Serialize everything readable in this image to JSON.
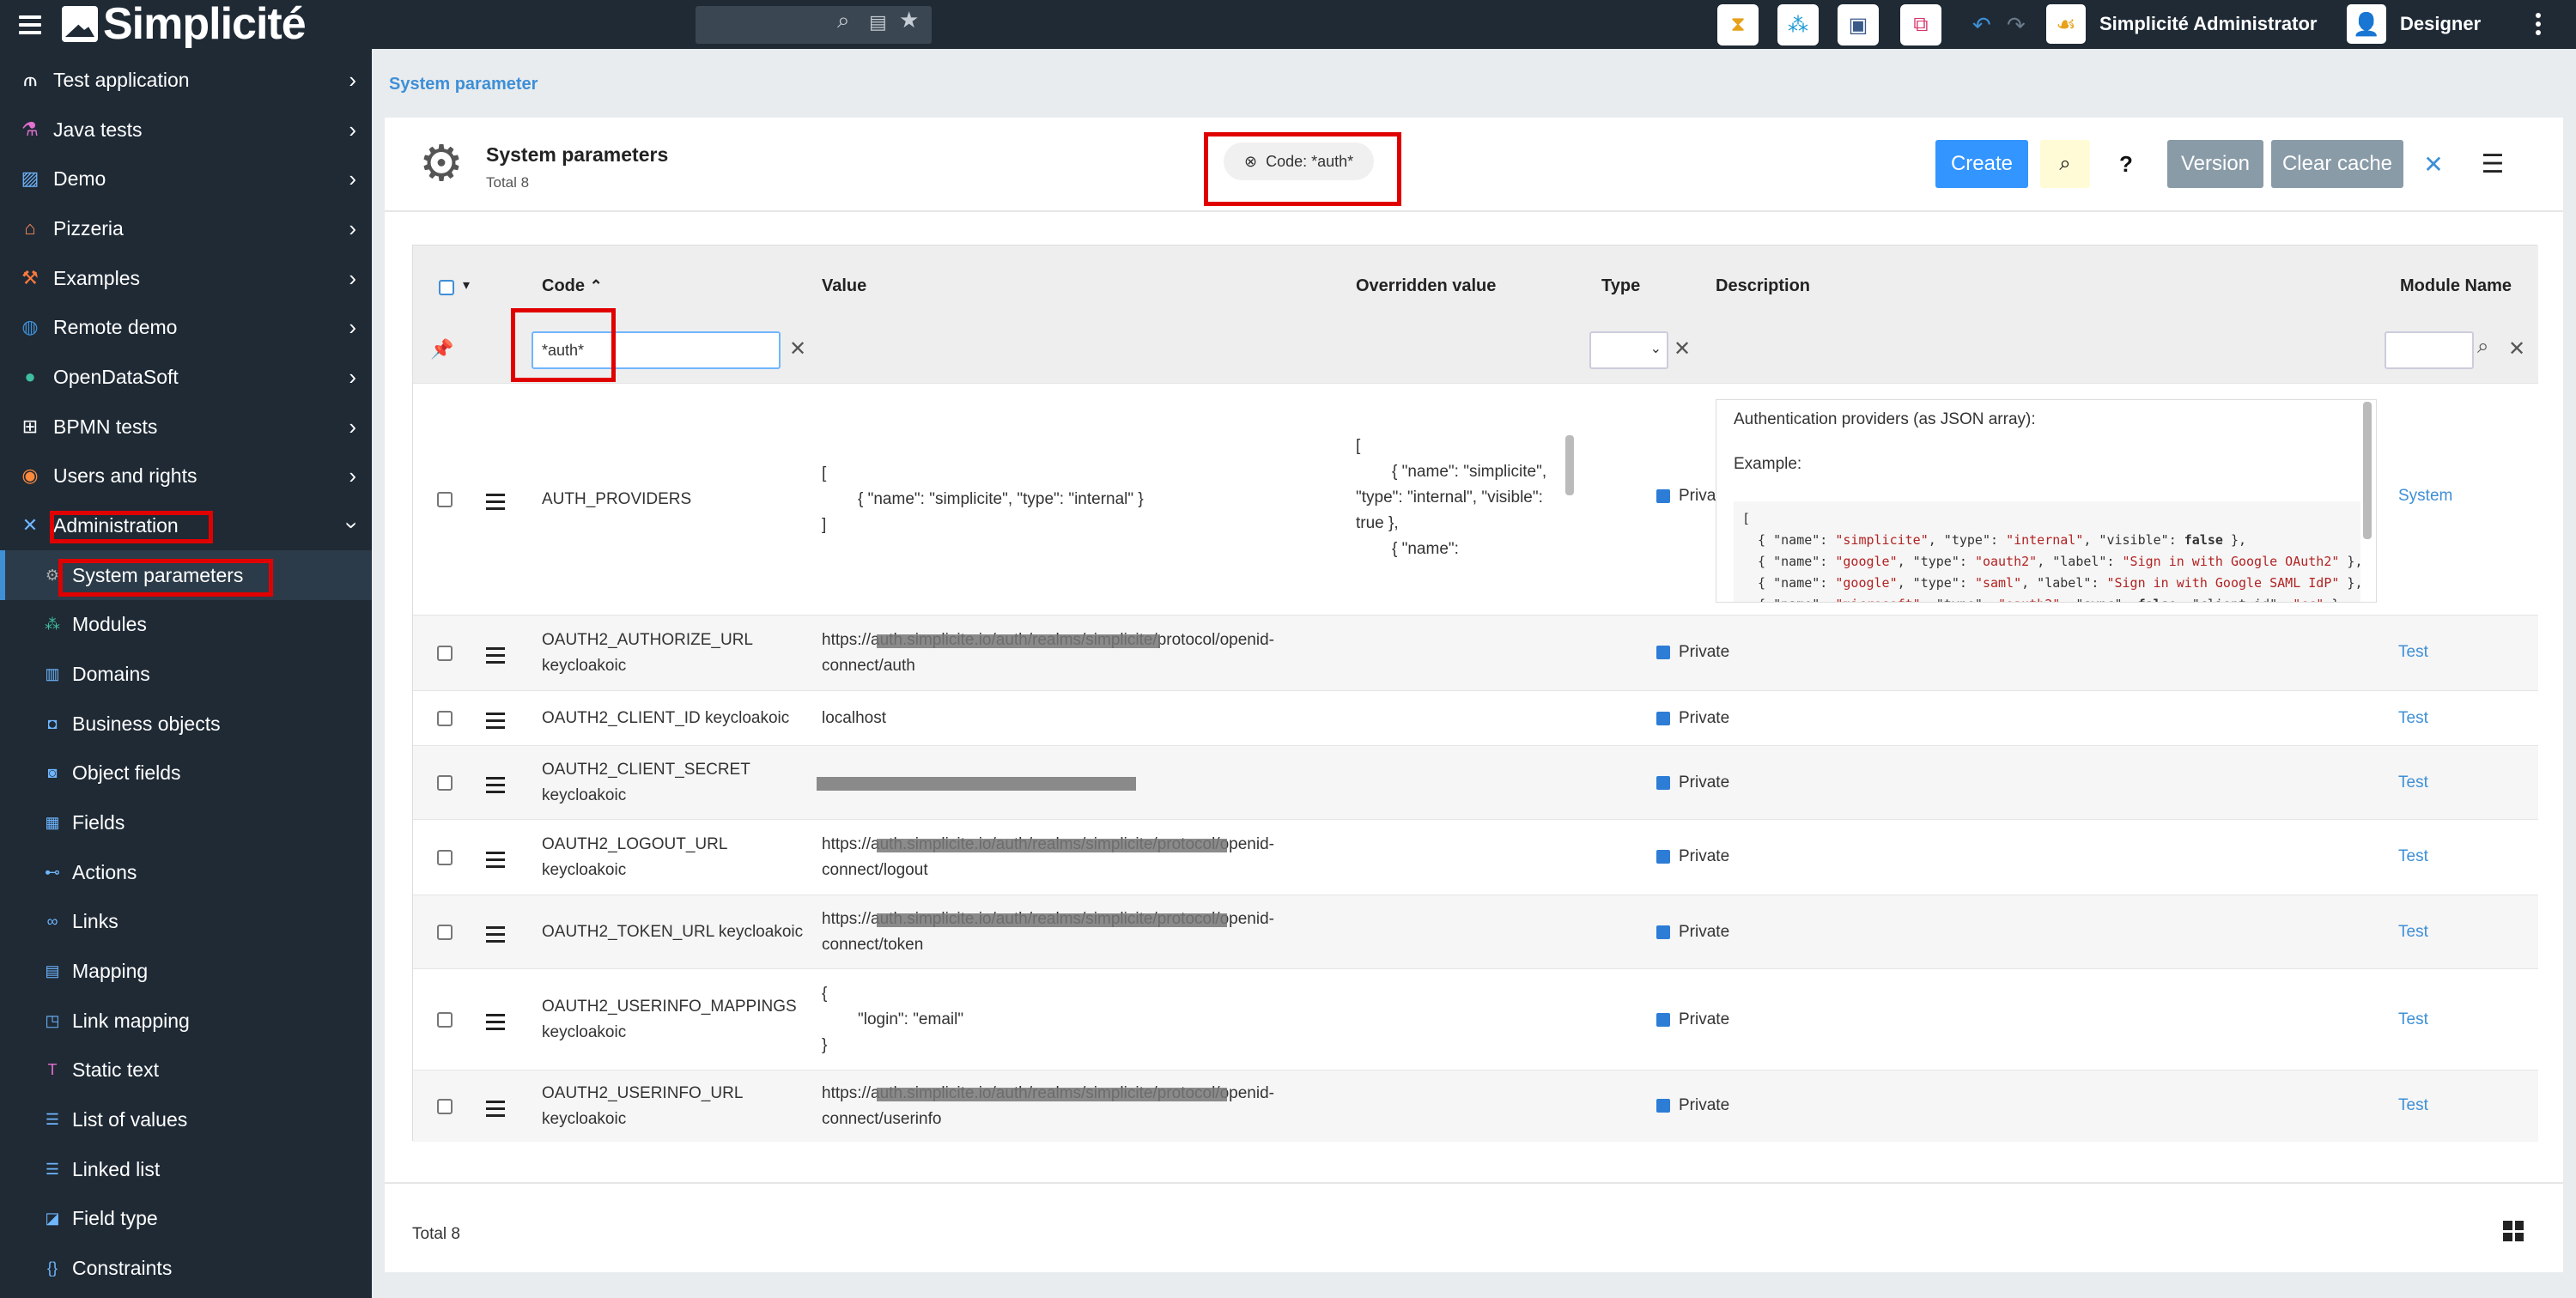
{
  "topbar": {
    "logo_text": "Simplicité",
    "user_name": "Simplicité Administrator",
    "role": "Designer"
  },
  "sidebar": {
    "items": [
      {
        "label": "Test application",
        "icon": "hanger-icon"
      },
      {
        "label": "Java tests",
        "icon": "flask-icon"
      },
      {
        "label": "Demo",
        "icon": "image-icon"
      },
      {
        "label": "Pizzeria",
        "icon": "store-icon"
      },
      {
        "label": "Examples",
        "icon": "tools-icon"
      },
      {
        "label": "Remote demo",
        "icon": "globe-icon"
      },
      {
        "label": "OpenDataSoft",
        "icon": "ods-icon"
      },
      {
        "label": "BPMN tests",
        "icon": "workflow-icon"
      },
      {
        "label": "Users and rights",
        "icon": "user-circle-icon"
      },
      {
        "label": "Administration",
        "icon": "cross-tools-icon"
      }
    ],
    "subitems": [
      {
        "label": "System parameters",
        "icon": "gear-icon"
      },
      {
        "label": "Modules",
        "icon": "cubes-icon"
      },
      {
        "label": "Domains",
        "icon": "book-icon"
      },
      {
        "label": "Business objects",
        "icon": "cube-icon"
      },
      {
        "label": "Object fields",
        "icon": "field-icon"
      },
      {
        "label": "Fields",
        "icon": "fields-icon"
      },
      {
        "label": "Actions",
        "icon": "action-icon"
      },
      {
        "label": "Links",
        "icon": "link-icon"
      },
      {
        "label": "Mapping",
        "icon": "map-icon"
      },
      {
        "label": "Link mapping",
        "icon": "link-map-icon"
      },
      {
        "label": "Static text",
        "icon": "text-icon"
      },
      {
        "label": "List of values",
        "icon": "list-icon"
      },
      {
        "label": "Linked list",
        "icon": "linked-list-icon"
      },
      {
        "label": "Field type",
        "icon": "type-icon"
      },
      {
        "label": "Constraints",
        "icon": "braces-icon"
      }
    ]
  },
  "breadcrumb": "System parameter",
  "header": {
    "title": "System parameters",
    "total": "Total 8",
    "filter_chip": "Code: *auth*",
    "buttons": {
      "create": "Create",
      "version": "Version",
      "clear_cache": "Clear cache"
    }
  },
  "table": {
    "columns": [
      "Code",
      "Value",
      "Overridden value",
      "Type",
      "Description",
      "Module Name"
    ],
    "filter_value": "*auth*",
    "rows": [
      {
        "code": "AUTH_PROVIDERS",
        "value": [
          "[",
          "{ \"name\": \"simplicite\", \"type\": \"internal\" }",
          "]"
        ],
        "overridden": [
          "[",
          "{ \"name\": \"simplicite\",",
          "\"type\": \"internal\", \"visible\":",
          "true },",
          "{ \"name\":"
        ],
        "type": "Private",
        "desc_title": "Authentication providers (as JSON array):",
        "desc_example": "Example:",
        "module": "System"
      },
      {
        "code": [
          "OAUTH2_AUTHORIZE_URL",
          "keycloakoic"
        ],
        "value": [
          "https://auth.simplicite.io/auth/realms/simplicite/protocol/openid-",
          "connect/auth"
        ],
        "type": "Private",
        "module": "Test"
      },
      {
        "code": [
          "OAUTH2_CLIENT_ID keycloakoic"
        ],
        "value": [
          "localhost"
        ],
        "type": "Private",
        "module": "Test"
      },
      {
        "code": [
          "OAUTH2_CLIENT_SECRET",
          "keycloakoic"
        ],
        "value": [
          ""
        ],
        "type": "Private",
        "module": "Test"
      },
      {
        "code": [
          "OAUTH2_LOGOUT_URL",
          "keycloakoic"
        ],
        "value": [
          "https://auth.simplicite.io/auth/realms/simplicite/protocol/openid-",
          "connect/logout"
        ],
        "type": "Private",
        "module": "Test"
      },
      {
        "code": [
          "OAUTH2_TOKEN_URL keycloakoic"
        ],
        "value": [
          "https://auth.simplicite.io/auth/realms/simplicite/protocol/openid-",
          "connect/token"
        ],
        "type": "Private",
        "module": "Test"
      },
      {
        "code": [
          "OAUTH2_USERINFO_MAPPINGS",
          "keycloakoic"
        ],
        "value": [
          "{",
          "\"login\": \"email\"",
          "}"
        ],
        "type": "Private",
        "module": "Test"
      },
      {
        "code": [
          "OAUTH2_USERINFO_URL",
          "keycloakoic"
        ],
        "value": [
          "https://auth.simplicite.io/auth/realms/simplicite/protocol/openid-",
          "connect/userinfo"
        ],
        "type": "Private",
        "module": "Test"
      }
    ]
  },
  "footer": {
    "total": "Total 8"
  },
  "colors": {
    "topbar": "#1f2a35",
    "accent": "#3e8fd6",
    "create": "#3395ff",
    "highlight": "#e00000"
  }
}
